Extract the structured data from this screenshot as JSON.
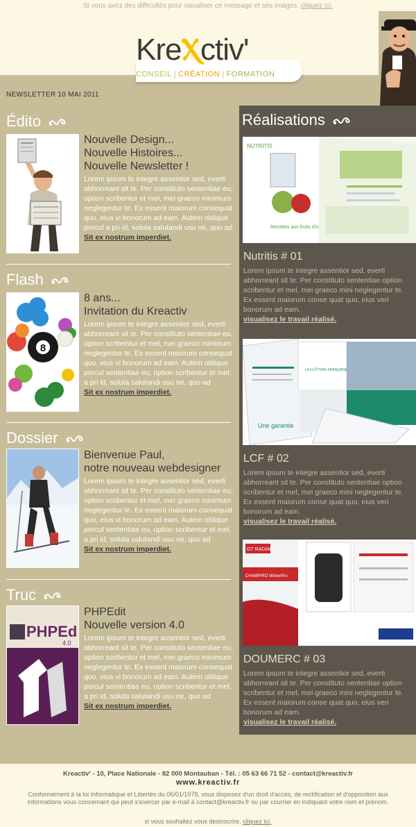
{
  "top_notice": {
    "text": "Si vous avez des difficultés pour visualiser ce message et ses images.",
    "link": "cliquez ici."
  },
  "header": {
    "logo_part1": "Kre",
    "logo_part2": "Ⲭ",
    "logo_part3": "ctiv'",
    "tagline": [
      "CONSEIL",
      "CRÉATION",
      "FORMATION"
    ],
    "tagline_separator": "|",
    "newsletter_date": "NEWSLETTER 10 MAI 2011"
  },
  "sections": [
    {
      "title": "Édito",
      "headline": [
        "Nouvelle Design...",
        "Nouvelle Histoires...",
        "Nouvelle Newsletter !"
      ],
      "body": "Lorem ipsum te integre assentior sed, everti abhorreant sit te. Per constituto sententiae eu, option scribentur et mel, mei graeco minimum neglegentur te. Ex essent maiorum consequat quo, eius vi bonorum ad eam. Autem oblique percul a pri id, soluta salutandi usu ne, quo ad",
      "link": "Sit ex nostrum imperdiet."
    },
    {
      "title": "Flash",
      "headline": [
        "8 ans...",
        "Invitation du Kreactiv"
      ],
      "body": "Lorem ipsum te integre assentior sed, everti abhorreant sit te. Per constituto sententiae eu, option scribentur et mel, mei graeco minimum neglegentur te. Ex essent maiorum consequat quo, eius vi bonorum ad eam. Autem oblique percul sententiae eu, option scribentur et mel, a pri id, soluta salutandi usu ne, quo ad",
      "link": "Sit ex nostrum imperdiet."
    },
    {
      "title": "Dossier",
      "headline": [
        "Bienvenue Paul,",
        "notre nouveau webdesigner"
      ],
      "body": "Lorem ipsum te integre assentior sed, everti abhorreant sit te. Per constituto sententiae eu, option scribentur et mel, mei graeco minimum neglegentur te. Ex essent maiorum consequat quo, eius vi bonorum ad eam. Autem oblique percul sententiae eu, option scribentur et mel, a pri id, soluta salutandi usu ne, quo ad",
      "link": "Sit ex nostrum imperdiet."
    },
    {
      "title": "Truc",
      "headline": [
        "PHPEdit",
        "Nouvelle version 4.0"
      ],
      "body": "Lorem ipsum te integre assentior sed, everti abhorreant sit te. Per constituto sententiae eu, option scribentur et mel, mei graeco minimum neglegentur te. Ex essent maiorum consequat quo, eius vi bonorum ad eam. Autem oblique percul sententiae eu, option scribentur et mel, a pri id, soluta salutandi usu ne, quo ad",
      "link": "Sit ex nostrum imperdiet.",
      "thumb_text": "PHPEd",
      "thumb_version": "4.0"
    }
  ],
  "realisations": {
    "title": "Réalisations",
    "projects": [
      {
        "title": "Nutritis # 01",
        "body": "Lorem ipsum te integre assentior sed, everti abhorreant sit te. Per constituto sententiae option scribentur et mel, mei graeco mini neglegentur te. Ex essent maiorum conse quat quo, eius veri bonorum ad eam.",
        "link": "visualisez le travail réalisé.",
        "img_label": "NUTRITIS",
        "img_caption": "Recettes aux fruits d'ici"
      },
      {
        "title": "LCF # 02",
        "body": "Lorem ipsum te integre assentior sed, everti abhorreant sit te. Per constituto sententiae option scribentur et mel, mei graeco mini neglegentur te. Ex essent maiorum conse quat quo, eius veri bonorum ad eam.",
        "link": "visualisez le travail réalisé.",
        "img_label": "LA CLÔTURE FRANÇAISE",
        "img_caption": "Une garantie"
      },
      {
        "title": "DOUMERC # 03",
        "body": "Lorem ipsum te integre assentior sed, everti abhorreant sit te. Per constituto sententiae option scribentur et mel, mei graeco mini neglegentur te. Ex essent maiorum conse quat quo, eius veri bonorum ad eam.",
        "link": "visualisez le travail réalisé.",
        "img_label": "GT RADIAL",
        "img_caption": "CHAMPIRO WinterPro"
      }
    ]
  },
  "footer": {
    "address": "Kreactiv' - 10, Place Nationale - 82 000 Montauban - Tél. : 05 63 66 71 52 - contact@kreactiv.fr",
    "website": "www.kreactiv.fr",
    "legal": "Conformément à la loi Informatique et Libertés du 06/01/1978, vous disposez d'un droit d'accès, de rectification et d'opposition aux informations vous concernant qui peut s'exercer par e-mail à contact@kreactiv.fr ou par courrier en indiquant votre nom et prénom.",
    "unsubscribe_text": "si vous souhaitez vous desinscrire,",
    "unsubscribe_link": "cliquez ici."
  },
  "colors": {
    "page_bg": "#fdf8e4",
    "left_column_bg": "#c7bd98",
    "right_column_bg": "#5d564d",
    "accent_yellow": "#f4c200"
  }
}
